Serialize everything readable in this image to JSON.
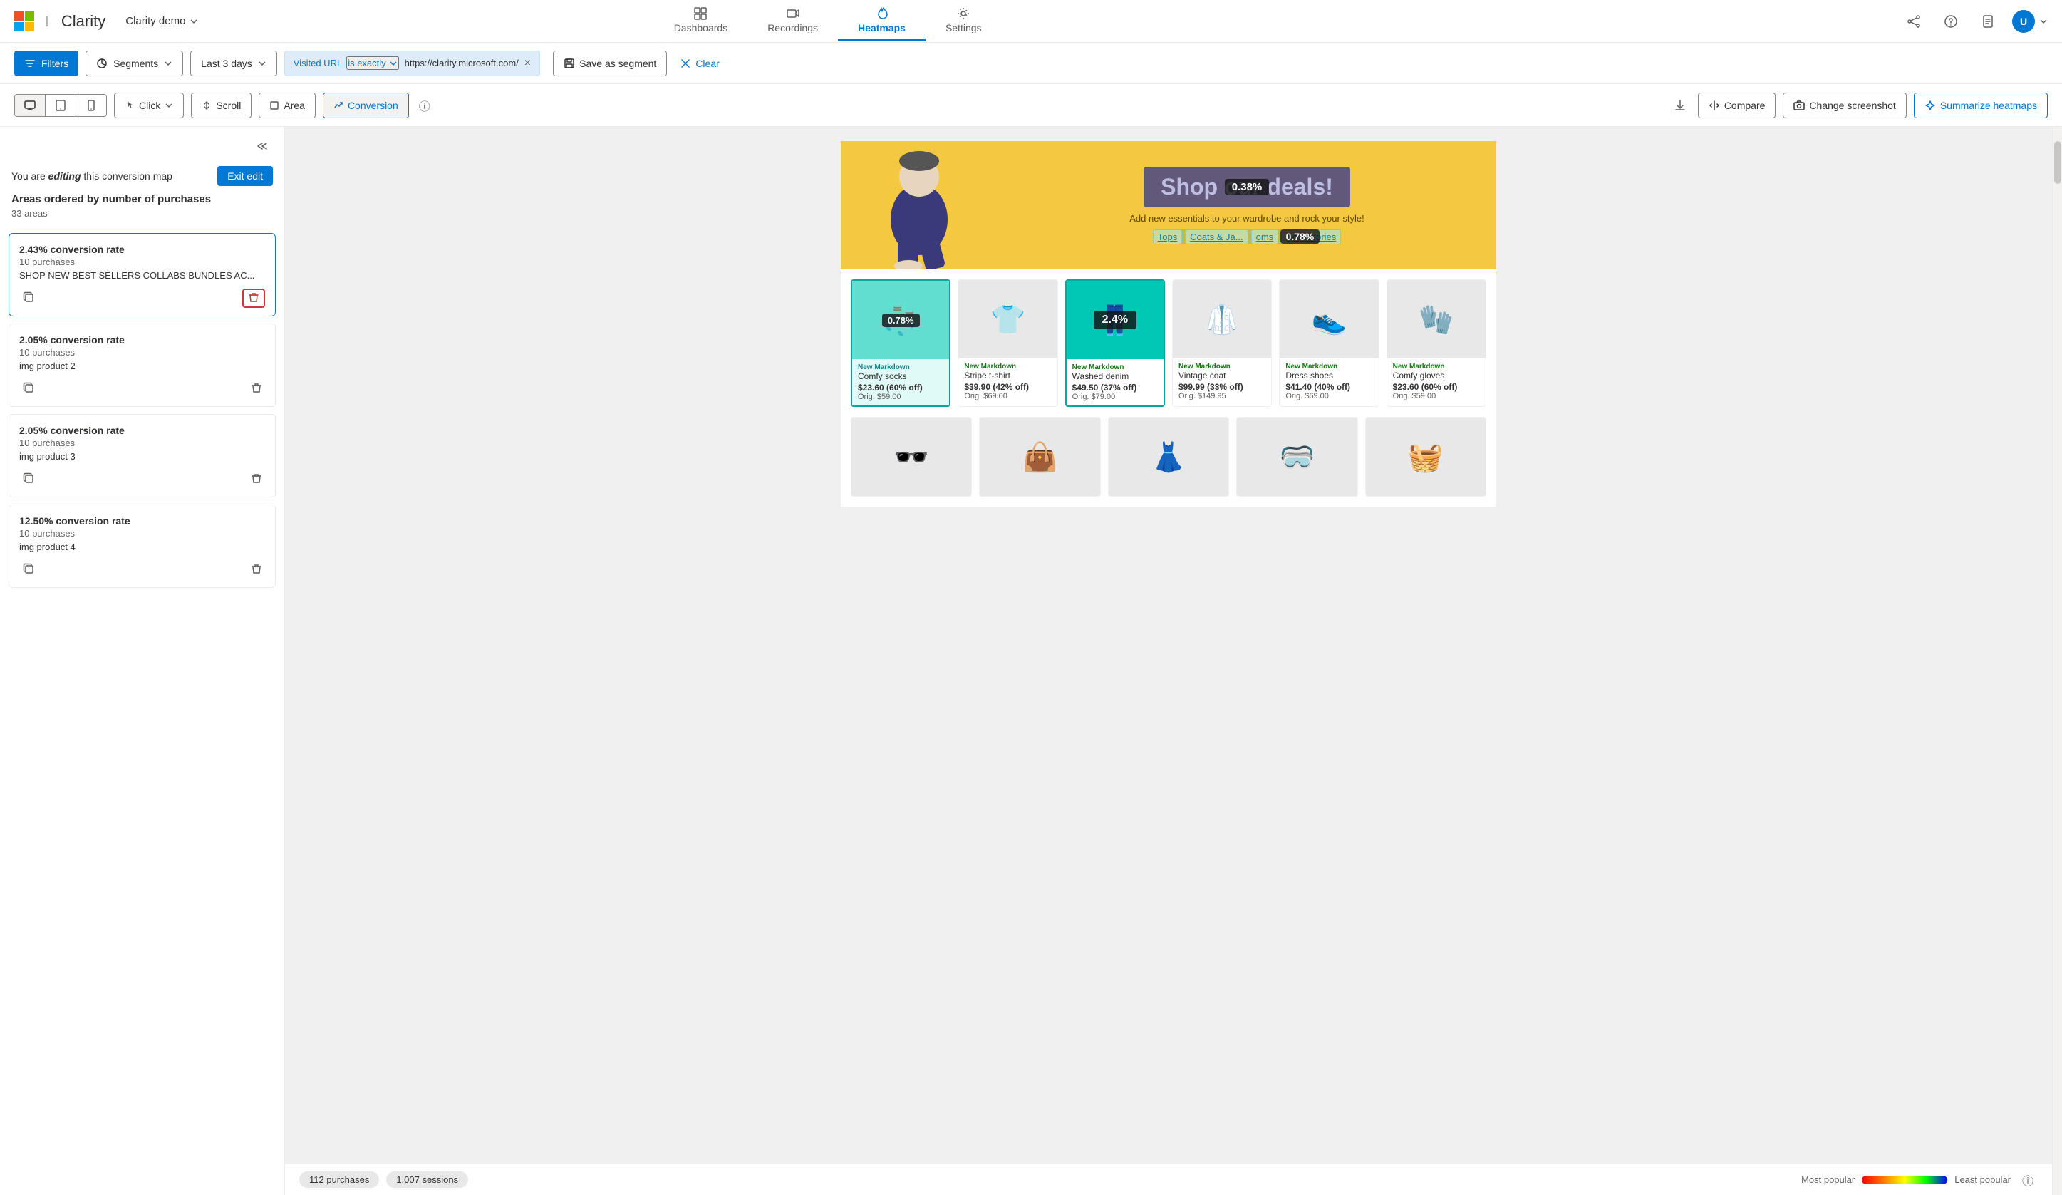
{
  "app": {
    "brand": "Clarity",
    "ms_logo_alt": "Microsoft logo",
    "demo_name": "Clarity demo"
  },
  "nav": {
    "items": [
      {
        "id": "dashboards",
        "label": "Dashboards",
        "icon": "grid-icon",
        "active": false
      },
      {
        "id": "recordings",
        "label": "Recordings",
        "icon": "video-icon",
        "active": false
      },
      {
        "id": "heatmaps",
        "label": "Heatmaps",
        "icon": "flame-icon",
        "active": true
      },
      {
        "id": "settings",
        "label": "Settings",
        "icon": "gear-icon",
        "active": false
      }
    ]
  },
  "filter_bar": {
    "filters_label": "Filters",
    "segments_label": "Segments",
    "date_label": "Last 3 days",
    "filter_field": "Visited URL",
    "filter_op": "is exactly",
    "filter_val": "https://clarity.microsoft.com/",
    "save_segment_label": "Save as segment",
    "clear_label": "Clear"
  },
  "toolbar": {
    "view_desktop": "desktop-icon",
    "view_tablet": "tablet-icon",
    "view_mobile": "mobile-icon",
    "click_label": "Click",
    "scroll_label": "Scroll",
    "area_label": "Area",
    "conversion_label": "Conversion",
    "download_icon": "download-icon",
    "compare_label": "Compare",
    "change_screenshot_label": "Change screenshot",
    "summarize_label": "Summarize heatmaps"
  },
  "sidebar": {
    "editing_text_pre": "You are",
    "editing_highlight": "editing",
    "editing_text_post": "this conversion map",
    "exit_edit_label": "Exit edit",
    "areas_title": "Areas ordered by number of purchases",
    "areas_count": "33 areas",
    "areas": [
      {
        "rate": "2.43% conversion rate",
        "purchases": "10 purchases",
        "name": "SHOP NEW BEST SELLERS COLLABS BUNDLES AC...",
        "delete_active": true
      },
      {
        "rate": "2.05% conversion rate",
        "purchases": "10 purchases",
        "name": "img product 2",
        "delete_active": false
      },
      {
        "rate": "2.05% conversion rate",
        "purchases": "10 purchases",
        "name": "img product 3",
        "delete_active": false
      },
      {
        "rate": "12.50% conversion rate",
        "purchases": "10 purchases",
        "name": "img product 4",
        "delete_active": false
      }
    ]
  },
  "heatmap": {
    "hero_headline": "Shop our deals!",
    "hero_subtext": "Add new essentials to your wardrobe and rock your style!",
    "hero_nav": [
      "Tops",
      "Coats & Ja...",
      "oms",
      "Accessories"
    ],
    "overlay_hero_pct": "0.38%",
    "overlay_nav_pct": "0.78%",
    "overlay_product3_pct": "2.4%",
    "overlay_socks_pct": "0.78%",
    "products": [
      {
        "emoji": "🧦",
        "badge": "New Markdown",
        "name": "Comfy socks",
        "price": "$23.60 (60% off)",
        "orig": "Orig. $59.00",
        "highlight": true
      },
      {
        "emoji": "👕",
        "badge": "New Markdown",
        "name": "Stripe t-shirt",
        "price": "$39.90 (42% off)",
        "orig": "Orig. $69.00",
        "highlight": false
      },
      {
        "emoji": "👖",
        "badge": "New Markdown",
        "name": "Washed denim",
        "price": "$49.50 (37% off)",
        "orig": "Orig. $79.00",
        "highlight": true
      },
      {
        "emoji": "🥼",
        "badge": "New Markdown",
        "name": "Vintage coat",
        "price": "$99.99 (33% off)",
        "orig": "Orig. $149.95",
        "highlight": false
      },
      {
        "emoji": "👟",
        "badge": "New Markdown",
        "name": "Dress shoes",
        "price": "$41.40 (40% off)",
        "orig": "Orig. $69.00",
        "highlight": false
      },
      {
        "emoji": "🧤",
        "badge": "New Markdown",
        "name": "Comfy gloves",
        "price": "$23.60 (60% off)",
        "orig": "Orig. $59.00",
        "highlight": false
      }
    ],
    "products2": [
      {
        "emoji": "🕶️",
        "highlight": false
      },
      {
        "emoji": "👜",
        "highlight": false
      },
      {
        "emoji": "👗",
        "highlight": false
      },
      {
        "emoji": "🥽",
        "highlight": false
      },
      {
        "emoji": "🧺",
        "highlight": false
      }
    ]
  },
  "status_bar": {
    "purchases_label": "112 purchases",
    "sessions_label": "1,007 sessions",
    "legend_most": "Most popular",
    "legend_least": "Least popular"
  }
}
